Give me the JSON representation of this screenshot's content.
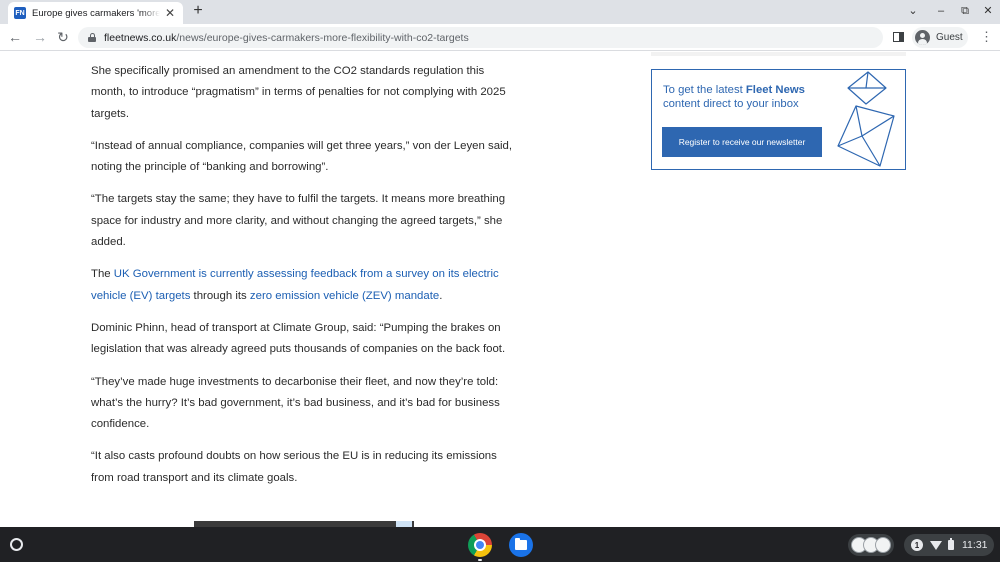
{
  "browser": {
    "tab": {
      "favicon_text": "FN",
      "title": "Europe gives carmakers 'more fl",
      "close": "✕"
    },
    "new_tab": "+",
    "window_controls": {
      "dropdown": "⌄",
      "minimize": "–",
      "restore": "⧉",
      "close": "✕"
    },
    "url": {
      "domain": "fleetnews.co.uk",
      "path": "/news/europe-gives-carmakers-more-flexibility-with-co2-targets"
    },
    "profile_label": "Guest",
    "icons": [
      "back-arrow-icon",
      "forward-arrow-icon",
      "reload-icon",
      "lock-icon",
      "side-panel-icon",
      "avatar-icon",
      "kebab-menu-icon"
    ]
  },
  "article": {
    "p1": "She specifically promised an amendment to the CO2 standards regulation this month, to introduce “pragmatism” in terms of penalties for not complying with 2025 targets.",
    "p2": "“Instead of annual compliance, companies will get three years,” von der Leyen said, noting the principle of “banking and borrowing”.",
    "p3": "“The targets stay the same; they have to fulfil the targets. It means more breathing space for industry and more clarity, and without changing the agreed targets,” she added.",
    "p4": {
      "pre": "The ",
      "link1": "UK Government is currently assessing feedback from a survey on its electric vehicle (EV) targets",
      "mid": " through its ",
      "link2": "zero emission vehicle (ZEV) mandate",
      "post": "."
    },
    "p5": "Dominic Phinn, head of transport at Climate Group, said: “Pumping the brakes on legislation that was already agreed puts thousands of companies on the back foot.",
    "p6": "“They’ve made huge investments to decarbonise their fleet, and now they’re told: what’s the hurry? It’s bad government, it’s bad business, and it’s bad for business confidence.",
    "p7": "“It also casts profound doubts on how serious the EU is in reducing its emissions from road transport and its climate goals."
  },
  "newsletter": {
    "text_pre": "To get the latest ",
    "brand": "Fleet News",
    "text_post": " content direct to your inbox",
    "button": "Register to receive our newsletter",
    "accent": "#2e67b1"
  },
  "shelf": {
    "notification_count": "1",
    "time": "11:31",
    "icons": [
      "launcher-icon",
      "chrome-icon",
      "files-icon",
      "wifi-icon",
      "battery-icon"
    ]
  }
}
